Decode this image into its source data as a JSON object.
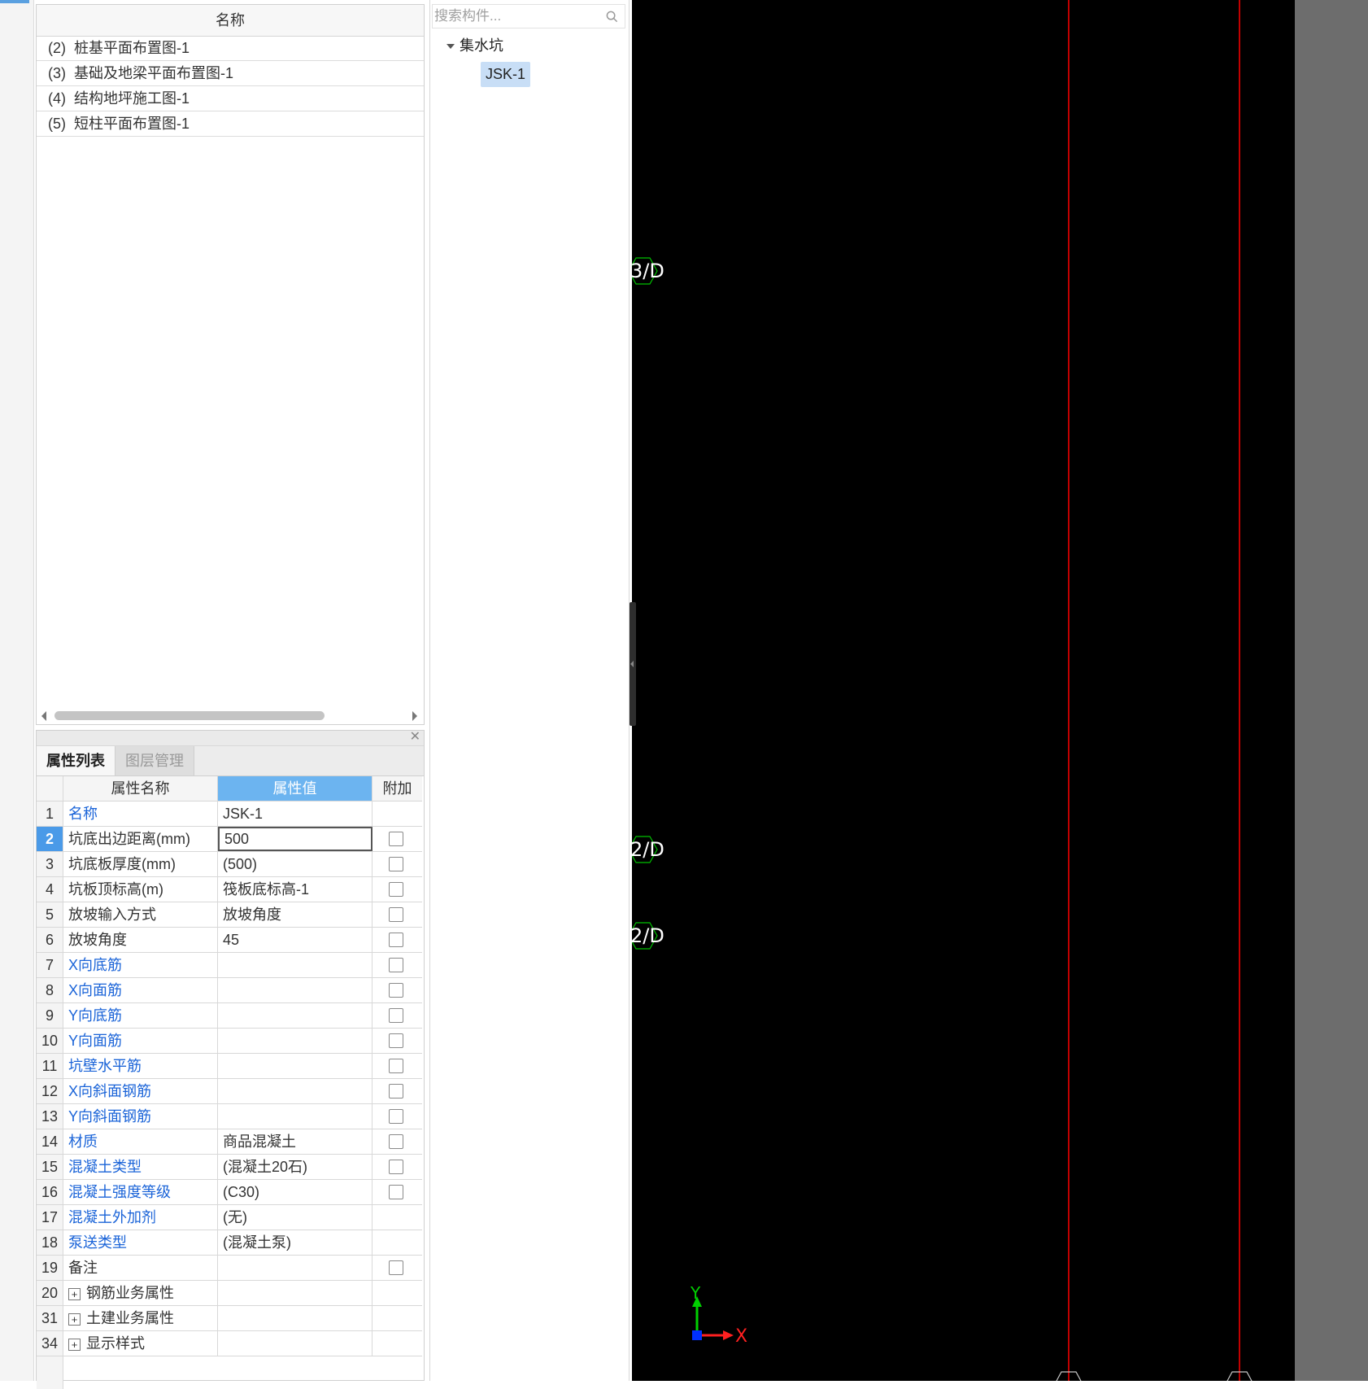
{
  "drawing_list": {
    "header": "名称",
    "rows": [
      {
        "num": "(2)",
        "label": "桩基平面布置图-1"
      },
      {
        "num": "(3)",
        "label": "基础及地梁平面布置图-1"
      },
      {
        "num": "(4)",
        "label": "结构地坪施工图-1"
      },
      {
        "num": "(5)",
        "label": "短柱平面布置图-1"
      }
    ]
  },
  "property_panel": {
    "tabs": [
      "属性列表",
      "图层管理"
    ],
    "columns": [
      "属性名称",
      "属性值",
      "附加"
    ],
    "rows": [
      {
        "no": "1",
        "name": "名称",
        "value": "JSK-1"
      },
      {
        "no": "2",
        "name": "坑底出边距离(mm)",
        "value": "500"
      },
      {
        "no": "3",
        "name": "坑底板厚度(mm)",
        "value": "(500)"
      },
      {
        "no": "4",
        "name": "坑板顶标高(m)",
        "value": "筏板底标高-1"
      },
      {
        "no": "5",
        "name": "放坡输入方式",
        "value": "放坡角度"
      },
      {
        "no": "6",
        "name": "放坡角度",
        "value": "45"
      },
      {
        "no": "7",
        "name": "X向底筋",
        "value": ""
      },
      {
        "no": "8",
        "name": "X向面筋",
        "value": ""
      },
      {
        "no": "9",
        "name": "Y向底筋",
        "value": ""
      },
      {
        "no": "10",
        "name": "Y向面筋",
        "value": ""
      },
      {
        "no": "11",
        "name": "坑壁水平筋",
        "value": ""
      },
      {
        "no": "12",
        "name": "X向斜面钢筋",
        "value": ""
      },
      {
        "no": "13",
        "name": "Y向斜面钢筋",
        "value": ""
      },
      {
        "no": "14",
        "name": "材质",
        "value": "商品混凝土"
      },
      {
        "no": "15",
        "name": "混凝土类型",
        "value": "(混凝土20石)"
      },
      {
        "no": "16",
        "name": "混凝土强度等级",
        "value": "(C30)"
      },
      {
        "no": "17",
        "name": "混凝土外加剂",
        "value": "(无)"
      },
      {
        "no": "18",
        "name": "泵送类型",
        "value": "(混凝土泵)"
      },
      {
        "no": "19",
        "name": "备注",
        "value": ""
      },
      {
        "no": "20",
        "name": "钢筋业务属性",
        "value": ""
      },
      {
        "no": "31",
        "name": "土建业务属性",
        "value": ""
      },
      {
        "no": "34",
        "name": "显示样式",
        "value": ""
      }
    ]
  },
  "component_panel": {
    "search_placeholder": "搜索构件...",
    "tree": {
      "root": "集水坑",
      "children": [
        "JSK-1"
      ]
    }
  },
  "canvas": {
    "labels": [
      "3/D",
      "2/D",
      "2/D"
    ],
    "axis_x": "X",
    "axis_y": "Y",
    "colors": {
      "background": "#000000",
      "grid_line": "#ff0000",
      "marker": "#00c000",
      "label": "#ffffff"
    }
  }
}
